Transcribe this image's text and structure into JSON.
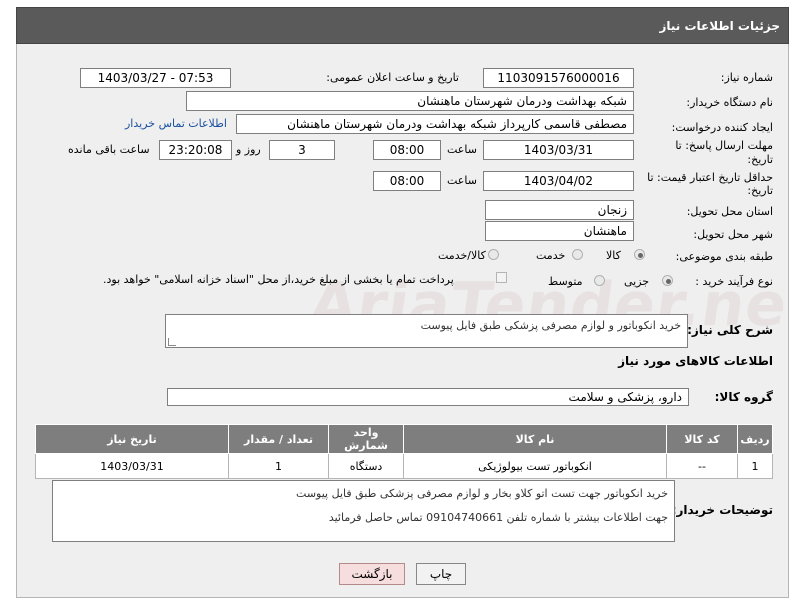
{
  "header": {
    "title": "جزئیات اطلاعات نیاز"
  },
  "watermark": "AriaTender.net",
  "form": {
    "need_number": {
      "label": "شماره نیاز:",
      "value": "1103091576000016"
    },
    "announce_datetime": {
      "label": "تاریخ و ساعت اعلان عمومی:",
      "value": "1403/03/27 - 07:53"
    },
    "buyer_name": {
      "label": "نام دستگاه خریدار:",
      "value": "شبکه بهداشت ودرمان شهرستان ماهنشان"
    },
    "creator": {
      "label": "ایجاد کننده درخواست:",
      "value": "مصطفی قاسمی کارپرداز شبکه بهداشت ودرمان شهرستان ماهنشان",
      "contact_link": "اطلاعات تماس خریدار"
    },
    "response_deadline": {
      "label_line1": "مهلت ارسال پاسخ: تا",
      "label_line2": "تاریخ:",
      "date": "1403/03/31",
      "time_label": "ساعت",
      "time": "08:00",
      "days": "3",
      "days_label": "روز و",
      "remaining_time": "23:20:08",
      "remaining_label": "ساعت باقی مانده"
    },
    "min_price_validity": {
      "label_line1": "حداقل تاریخ اعتبار قیمت: تا",
      "label_line2": "تاریخ:",
      "date": "1403/04/02",
      "time_label": "ساعت",
      "time": "08:00"
    },
    "delivery_province": {
      "label": "استان محل تحویل:",
      "value": "زنجان"
    },
    "delivery_city": {
      "label": "شهر محل تحویل:",
      "value": "ماهنشان"
    },
    "category": {
      "label": "طبقه بندی موضوعی:",
      "options": [
        "کالا",
        "خدمت",
        "کالا/خدمت"
      ],
      "selected": "کالا"
    },
    "process_type": {
      "label": "نوع فرآیند خرید :",
      "options": [
        "جزیی",
        "متوسط"
      ],
      "selected": "جزیی",
      "payment_note": "پرداخت تمام یا بخشی از مبلغ خرید،از محل \"اسناد خزانه اسلامی\" خواهد بود."
    },
    "general_description": {
      "label": "شرح کلی نیاز:",
      "value": "خرید انکوباتور و لوازم مصرفی پزشکی طبق فایل پیوست"
    }
  },
  "goods_section": {
    "title": "اطلاعات کالاهای مورد نیاز",
    "group_label": "گروه کالا:",
    "group_value": "دارو، پزشکی و سلامت",
    "table": {
      "headers": [
        "ردیف",
        "کد کالا",
        "نام کالا",
        "واحد شمارش",
        "تعداد / مقدار",
        "تاریخ نیاز"
      ],
      "rows": [
        [
          "1",
          "--",
          "انکوباتور تست بیولوژیکی",
          "دستگاه",
          "1",
          "1403/03/31"
        ]
      ]
    }
  },
  "buyer_notes": {
    "label": "توضیحات خریدار:",
    "line1": "خرید انکوباتور  جهت تست اتو کلاو بخار و لوازم مصرفی پزشکی طبق فایل پیوست",
    "line2": "جهت اطلاعات بیشتر با شماره تلفن 09104740661  تماس حاصل فرمائید"
  },
  "buttons": {
    "print": "چاپ",
    "back": "بازگشت"
  },
  "colors": {
    "header_bg": "#5a5a5a",
    "panel_bg": "#efefef",
    "table_header": "#7e7e7e",
    "link": "#1a4fa0",
    "back_button": "#f7dede"
  }
}
